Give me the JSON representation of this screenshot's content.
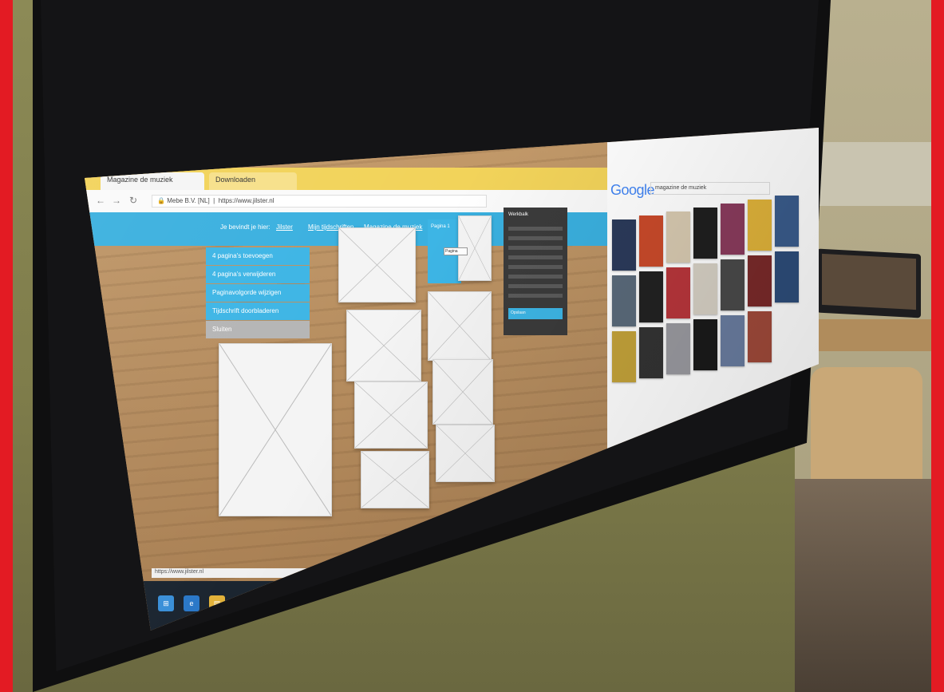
{
  "browser_left": {
    "tabs": [
      "Magazine de muziek",
      "Downloaden"
    ],
    "url_lock": "Mebe B.V. [NL]",
    "url": "https://www.jilster.nl",
    "sitebar_left": "Je bevindt je hier:",
    "sitebar_links": [
      "Jilster",
      "Mijn tijdschriften",
      "Magazine de muziek"
    ],
    "menu": [
      "4 pagina's toevoegen",
      "4 pagina's verwijderen",
      "Paginavolgorde wijzigen",
      "Tijdschrift doorbladeren",
      "Sluiten"
    ],
    "panel_blue_title": "Pagina 1",
    "tooltip_text": "Pagina",
    "dark_panel_title": "Werkbalk",
    "dark_panel_footer": "Opslaan",
    "status_url": "https://www.jilster.nl"
  },
  "browser_right": {
    "logo": "Google",
    "search_query": "magazine de muziek"
  },
  "icons": {
    "back": "arrow-left-icon",
    "forward": "arrow-right-icon",
    "reload": "reload-icon",
    "lock": "lock-icon"
  },
  "colors": {
    "frame": "#e31b23",
    "site_blue": "#3db5e5",
    "tab_yellow": "#f2d35a",
    "taskbar": "#1b2530"
  }
}
